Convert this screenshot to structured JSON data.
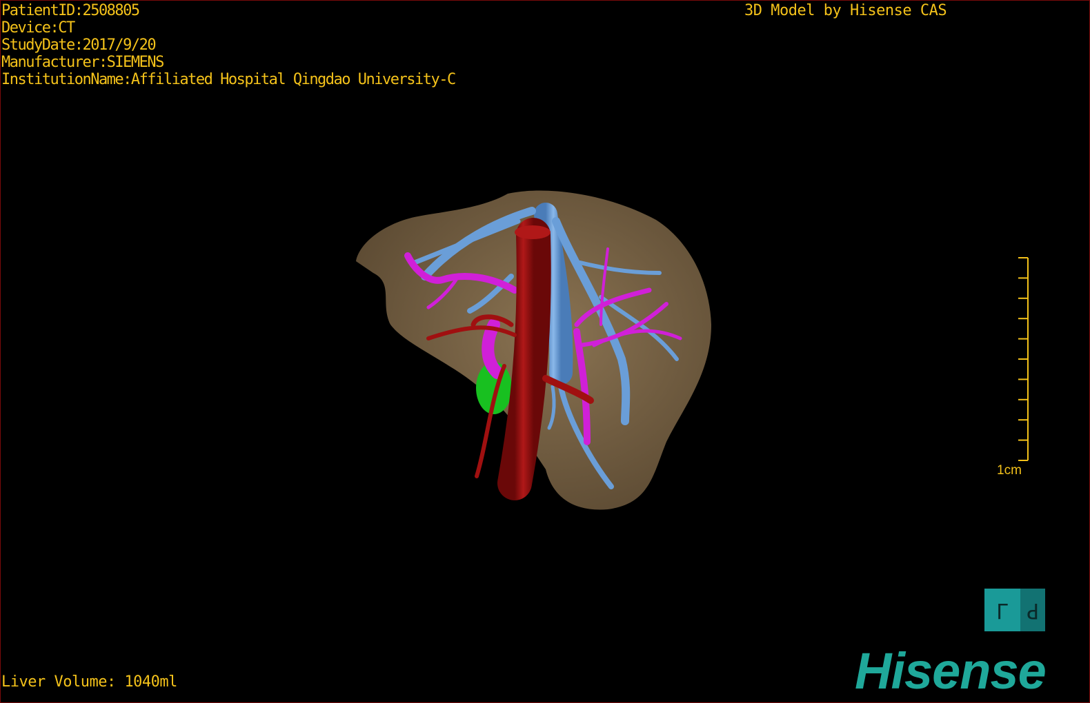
{
  "patient_info": {
    "patient_id": "PatientID:2508805",
    "device": "Device:CT",
    "study_date": "StudyDate:2017/9/20",
    "manufacturer": "Manufacturer:SIEMENS",
    "institution": "InstitutionName:Affiliated Hospital Qingdao University-C"
  },
  "header": {
    "brand_title": "3D Model by Hisense CAS"
  },
  "footer": {
    "liver_volume": "Liver Volume: 1040ml"
  },
  "scale_bar": {
    "label": "1cm",
    "ticks": 11
  },
  "orientation_cube": {
    "face_left": "L",
    "face_right": "P"
  },
  "logo": {
    "text": "Hisense"
  },
  "colors": {
    "text": "#f4c21a",
    "liver": "#7a6446",
    "hepatic_vein": "#6a9ed8",
    "portal_vein": "#d020d8",
    "artery": "#a01010",
    "gallbladder": "#18c020",
    "brand": "#1fa89a"
  }
}
